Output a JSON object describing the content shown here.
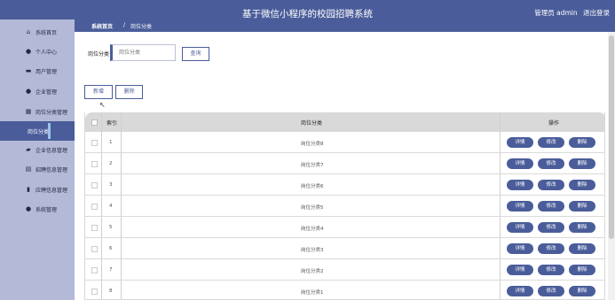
{
  "header": {
    "title": "基于微信小程序的校园招聘系统",
    "user_label": "管理员 admin",
    "logout_label": "退出登录"
  },
  "sidebar": {
    "items": [
      {
        "label": "系统首页",
        "icon": "home-icon"
      },
      {
        "label": "个人中心",
        "icon": "person-icon"
      },
      {
        "label": "用户管理",
        "icon": "monitor-icon"
      },
      {
        "label": "企业管理",
        "icon": "person-icon"
      },
      {
        "label": "岗位分类管理",
        "icon": "grid-icon"
      },
      {
        "label": "岗位分类",
        "icon": "",
        "active": true
      },
      {
        "label": "企业信息管理",
        "icon": "briefcase-icon"
      },
      {
        "label": "招聘信息管理",
        "icon": "document-icon"
      },
      {
        "label": "应聘信息管理",
        "icon": "database-icon"
      },
      {
        "label": "系统管理",
        "icon": "location-icon"
      }
    ]
  },
  "breadcrumb": {
    "root": "系统首页",
    "separator": "/",
    "current": "岗位分类"
  },
  "search": {
    "label": "岗位分类",
    "placeholder": "岗位分类",
    "query_label": "查询"
  },
  "actions": {
    "add_label": "新增",
    "delete_label": "删除"
  },
  "table": {
    "headers": {
      "index": "索引",
      "category": "岗位分类",
      "operation": "操作"
    },
    "row_buttons": {
      "detail": "详情",
      "edit": "修改",
      "delete": "删除"
    },
    "rows": [
      {
        "index": "1",
        "category": "岗位分类8"
      },
      {
        "index": "2",
        "category": "岗位分类7"
      },
      {
        "index": "3",
        "category": "岗位分类6"
      },
      {
        "index": "4",
        "category": "岗位分类5"
      },
      {
        "index": "5",
        "category": "岗位分类4"
      },
      {
        "index": "6",
        "category": "岗位分类3"
      },
      {
        "index": "7",
        "category": "岗位分类2"
      },
      {
        "index": "8",
        "category": "岗位分类1"
      }
    ]
  },
  "colors": {
    "primary": "#4a5d9a",
    "sidebar_bg": "#b3b9d6",
    "table_header_bg": "#d9d9d9"
  }
}
